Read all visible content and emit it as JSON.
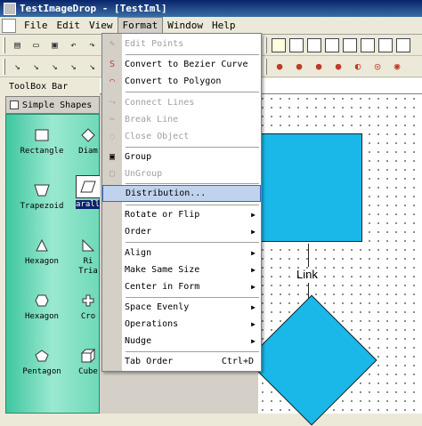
{
  "window": {
    "title": "TestImageDrop - [TestIml]"
  },
  "menubar": {
    "items": [
      "File",
      "Edit",
      "View",
      "Format",
      "Window",
      "Help"
    ]
  },
  "toolbox": {
    "bar_label": "ToolBox Bar",
    "header": "Simple Shapes",
    "shapes": [
      {
        "label": "Rectangle"
      },
      {
        "label": "Diam"
      },
      {
        "label": "Trapezoid"
      },
      {
        "label": "aralle"
      },
      {
        "label": "Hexagon"
      },
      {
        "label": "Ri Tria"
      },
      {
        "label": "Hexagon"
      },
      {
        "label": "Cro"
      },
      {
        "label": "Pentagon"
      },
      {
        "label": "Cube"
      }
    ]
  },
  "canvas": {
    "link_label": "Link"
  },
  "format_menu": {
    "items": [
      {
        "label": "Edit Points",
        "disabled": true
      },
      {
        "label": "Convert to Bezier Curve",
        "disabled": false
      },
      {
        "label": "Convert to Polygon",
        "disabled": false
      },
      {
        "label": "Connect Lines",
        "disabled": true
      },
      {
        "label": "Break Line",
        "disabled": true
      },
      {
        "label": "Close Object",
        "disabled": true
      },
      {
        "label": "Group",
        "disabled": false
      },
      {
        "label": "UnGroup",
        "disabled": true
      },
      {
        "label": "Distribution...",
        "disabled": false
      },
      {
        "label": "Rotate or Flip",
        "disabled": false
      },
      {
        "label": "Order",
        "disabled": false
      },
      {
        "label": "Align",
        "disabled": false
      },
      {
        "label": "Make Same Size",
        "disabled": false
      },
      {
        "label": "Center in Form",
        "disabled": false
      },
      {
        "label": "Space Evenly",
        "disabled": false
      },
      {
        "label": "Operations",
        "disabled": false
      },
      {
        "label": "Nudge",
        "disabled": false
      },
      {
        "label": "Tab Order",
        "disabled": false,
        "shortcut": "Ctrl+D"
      }
    ]
  }
}
